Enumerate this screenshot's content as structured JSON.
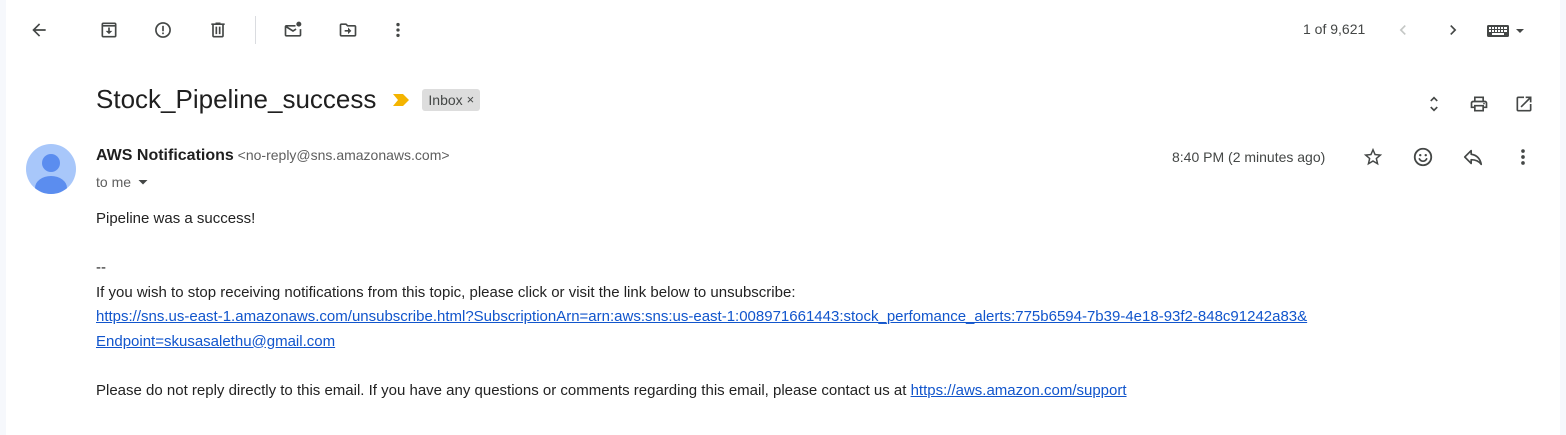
{
  "toolbar": {
    "back_icon": "arrow-back-icon",
    "archive_icon": "archive-icon",
    "spam_icon": "report-spam-icon",
    "delete_icon": "trash-icon",
    "mark_unread_icon": "mark-unread-icon",
    "move_icon": "move-to-folder-icon",
    "more_icon": "more-vert-icon",
    "pager_text": "1 of 9,621",
    "keyboard_icon": "keyboard-icon"
  },
  "subject": {
    "title": "Stock_Pipeline_success",
    "importance_color": "#f4b400",
    "label": "Inbox",
    "label_close": "×"
  },
  "sender": {
    "name": "AWS Notifications",
    "email": "<no-reply@sns.amazonaws.com>",
    "to": "to me",
    "time": "8:40 PM (2 minutes ago)",
    "avatar_color": "#a8c7fa"
  },
  "body": {
    "line1": "Pipeline was a success!",
    "separator": "--",
    "unsubscribe_text": "If you wish to stop receiving notifications from this topic, please click or visit the link below to unsubscribe:",
    "unsubscribe_link_line1": "https://sns.us-east-1.amazonaws.com/unsubscribe.html?SubscriptionArn=arn:aws:sns:us-east-1:008971661443:stock_perfomance_alerts:775b6594-7b39-4e18-93f2-848c91242a83&",
    "unsubscribe_link_line2": "Endpoint=skusasalethu@gmail.com",
    "footer_text": "Please do not reply directly to this email. If you have any questions or comments regarding this email, please contact us at ",
    "support_link": "https://aws.amazon.com/support"
  },
  "colors": {
    "link": "#1155cc",
    "icon": "#444746"
  }
}
